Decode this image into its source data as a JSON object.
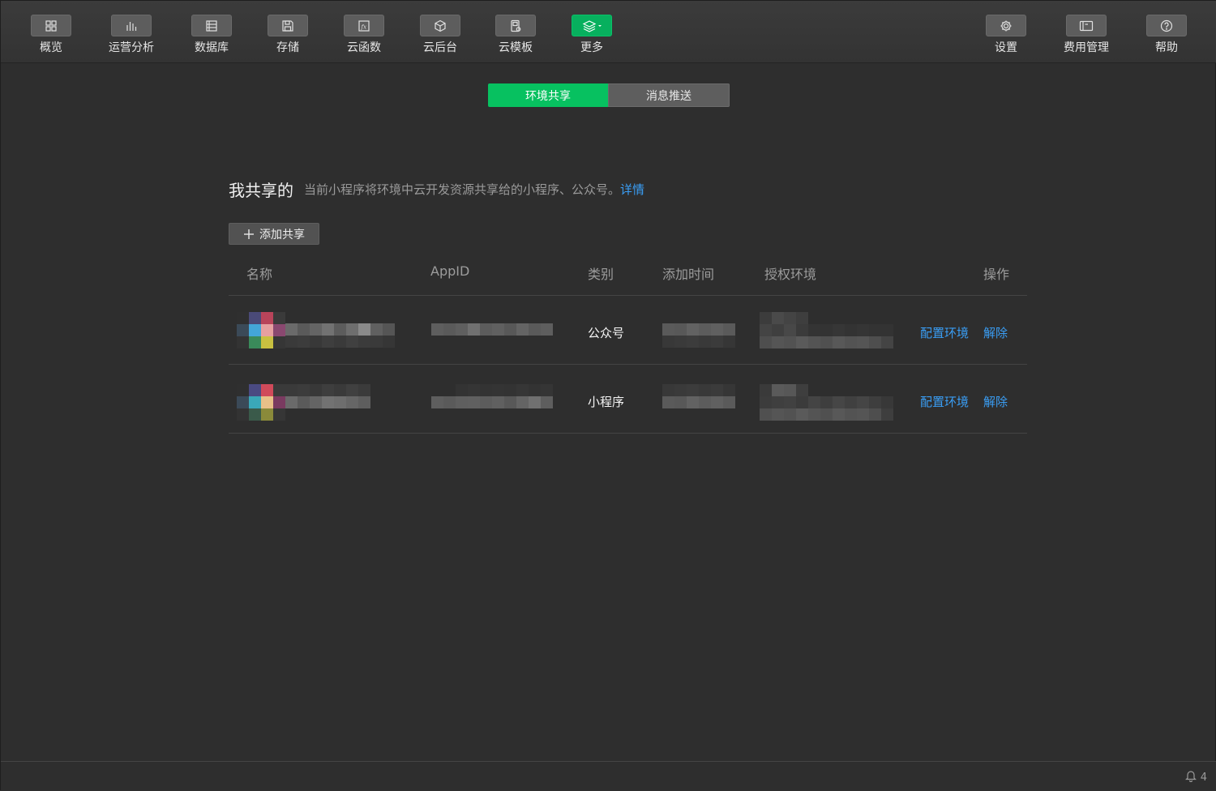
{
  "toolbar": {
    "left": [
      {
        "label": "概览",
        "icon": "grid-icon"
      },
      {
        "label": "运营分析",
        "icon": "bar-chart-icon"
      },
      {
        "label": "数据库",
        "icon": "database-icon"
      },
      {
        "label": "存储",
        "icon": "save-icon"
      },
      {
        "label": "云函数",
        "icon": "function-icon"
      },
      {
        "label": "云后台",
        "icon": "cube-icon"
      },
      {
        "label": "云模板",
        "icon": "template-icon"
      },
      {
        "label": "更多",
        "icon": "layers-icon"
      }
    ],
    "right": [
      {
        "label": "设置",
        "icon": "gear-icon"
      },
      {
        "label": "费用管理",
        "icon": "billing-icon"
      },
      {
        "label": "帮助",
        "icon": "help-icon"
      }
    ]
  },
  "tabs": {
    "env_share": "环境共享",
    "message_push": "消息推送"
  },
  "section": {
    "title": "我共享的",
    "description": "当前小程序将环境中云开发资源共享给的小程序、公众号。",
    "details_link": "详情",
    "add_button": "添加共享"
  },
  "table": {
    "headers": {
      "name": "名称",
      "appid": "AppID",
      "type": "类别",
      "added_time": "添加时间",
      "auth_env": "授权环境",
      "actions": "操作"
    },
    "rows": [
      {
        "type": "公众号",
        "configure": "配置环境",
        "remove": "解除"
      },
      {
        "type": "小程序",
        "configure": "配置环境",
        "remove": "解除"
      }
    ]
  },
  "statusbar": {
    "notification_count": "4"
  },
  "colors": {
    "accent_green": "#07c160",
    "link_blue": "#3a9ef5",
    "background": "#2e2e2e"
  }
}
